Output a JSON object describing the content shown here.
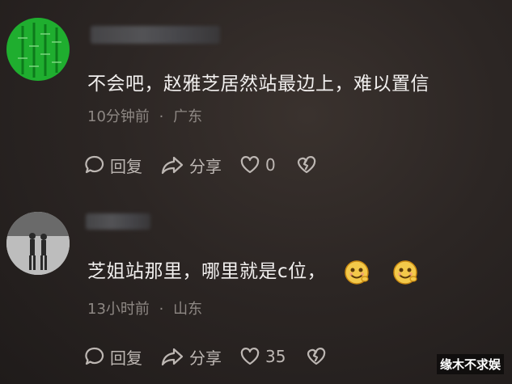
{
  "comments": [
    {
      "text": "不会吧，赵雅芝居然站最边上，难以置信",
      "time": "10分钟前",
      "sep": "·",
      "location": "广东",
      "reply_label": "回复",
      "share_label": "分享",
      "like_count": "0"
    },
    {
      "text": "芝姐站那里，哪里就是c位，",
      "time": "13小时前",
      "sep": "·",
      "location": "山东",
      "reply_label": "回复",
      "share_label": "分享",
      "like_count": "35"
    }
  ],
  "watermark": "缘木不求娱",
  "colors": {
    "avatar1": "#1fae2f",
    "meta": "#8e8884",
    "text": "#f1efee"
  }
}
